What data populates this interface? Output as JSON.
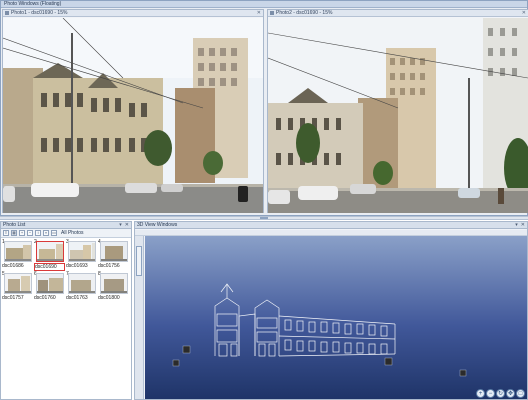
{
  "photo_window": {
    "title": "Photo Windows (Floating)",
    "left_pane_title": "Photo1 - dsc01690 - 15%",
    "right_pane_title": "Photo2 - dsc01690 - 15%"
  },
  "photo_list": {
    "title": "Photo List",
    "filter_label": "All Photos",
    "thumbnails": [
      {
        "num": "1",
        "label": "dsc01686",
        "selected": false
      },
      {
        "num": "2",
        "label": "dsc01690",
        "selected": true
      },
      {
        "num": "3",
        "label": "dsc01693",
        "selected": false
      },
      {
        "num": "4",
        "label": "dsc01756",
        "selected": false
      },
      {
        "num": "5",
        "label": "dsc01757",
        "selected": false
      },
      {
        "num": "6",
        "label": "dsc01760",
        "selected": false
      },
      {
        "num": "7",
        "label": "dsc01763",
        "selected": false
      },
      {
        "num": "8",
        "label": "dsc01800",
        "selected": false
      }
    ]
  },
  "view_window": {
    "title": "3D View Windows"
  },
  "colors": {
    "title_bar": "#c9d6e8",
    "selection": "#d93a3a",
    "scene_top": "#8aa0c8",
    "scene_bottom": "#1f3468"
  },
  "icons": [
    "close-icon",
    "pin-icon",
    "zoom-in-icon",
    "zoom-out-icon",
    "rotate-icon",
    "pan-icon",
    "fit-icon"
  ]
}
